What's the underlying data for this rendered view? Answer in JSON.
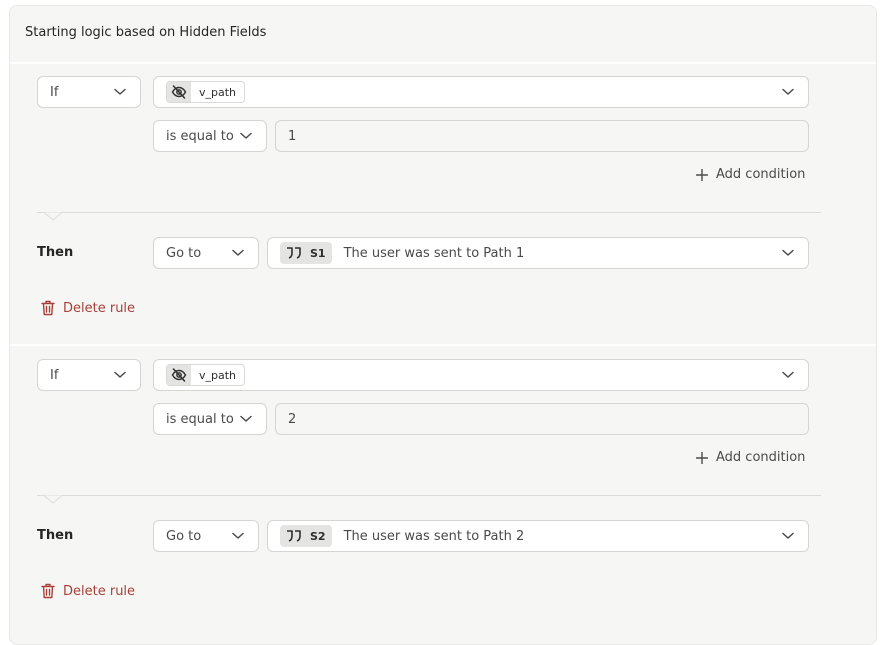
{
  "panel": {
    "title": "Starting logic based on Hidden Fields"
  },
  "rules": [
    {
      "if_label": "If",
      "field": "v_path",
      "operator": "is equal to",
      "value": "1",
      "add_condition": "Add condition",
      "then_label": "Then",
      "action": "Go to",
      "target_ref": "S1",
      "target_text": "The user was sent to Path 1",
      "delete_label": "Delete rule"
    },
    {
      "if_label": "If",
      "field": "v_path",
      "operator": "is equal to",
      "value": "2",
      "add_condition": "Add condition",
      "then_label": "Then",
      "action": "Go to",
      "target_ref": "S2",
      "target_text": "The user was sent to Path 2",
      "delete_label": "Delete rule"
    }
  ],
  "colors": {
    "panel_bg": "#f6f6f4",
    "delete": "#a8403a",
    "border": "#d5d5d3"
  },
  "icons": [
    "eye-off-icon",
    "chevron-down-icon",
    "plus-icon",
    "quote-icon",
    "trash-icon"
  ]
}
